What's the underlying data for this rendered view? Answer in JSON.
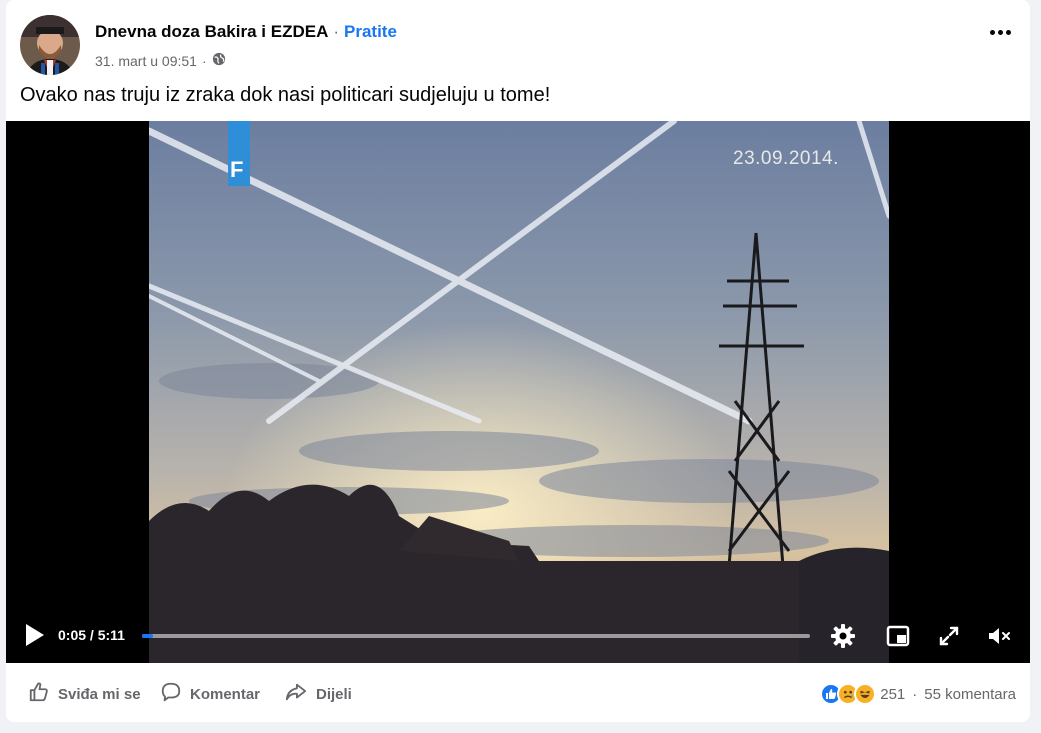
{
  "post": {
    "author": "Dnevna doza Bakira i EZDEA",
    "separator": "·",
    "follow_label": "Pratite",
    "timestamp": "31. mart u 09:51",
    "meta_separator": "·",
    "privacy_icon": "globe-icon",
    "text": "Ovako nas truju iz zraka dok nasi politicari sudjeluju u tome!",
    "more_icon": "more-options-icon"
  },
  "video": {
    "overlay_date": "23.09.2014.",
    "channel_badge": "F",
    "current_time": "0:05",
    "time_separator": " / ",
    "duration": "5:11",
    "progress_fraction": 0.016,
    "accent_color": "#1877f2",
    "icons": [
      "play-icon",
      "settings-icon",
      "picture-in-picture-icon",
      "fullscreen-icon",
      "muted-icon"
    ]
  },
  "actions": {
    "like_label": "Sviđa mi se",
    "comment_label": "Komentar",
    "share_label": "Dijeli",
    "reaction_icons": [
      "like-reaction-icon",
      "sad-reaction-icon",
      "haha-reaction-icon"
    ],
    "reaction_count": "251",
    "count_separator": "·",
    "comments_count": "55 komentara"
  }
}
